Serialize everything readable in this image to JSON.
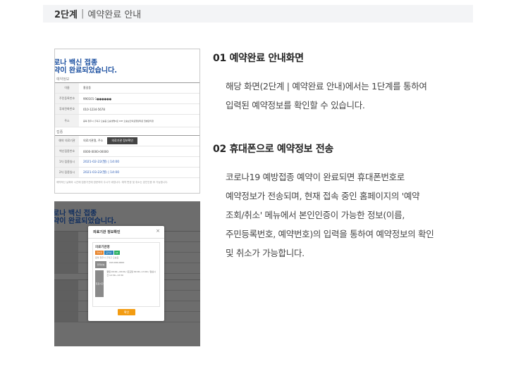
{
  "header": {
    "step": "2단계",
    "separator": "|",
    "title": "예약완료 안내"
  },
  "thumb1": {
    "line1": "로나 백신 접종",
    "line2": "약이 완료되었습니다.",
    "section1": "예약정보",
    "rows1": [
      {
        "key": "이름",
        "value": "홍길동"
      },
      {
        "key": "주민등록번호",
        "value": "990101-1●●●●●●"
      },
      {
        "key": "휴대전화번호",
        "value": "010-1234-5678"
      },
      {
        "key": "주소",
        "value": "충북 청주시 흥덕구 오송읍 오송생명2로 187 오송보건의료행정타운 질병관리청"
      }
    ],
    "section2": "접종",
    "rows2": [
      {
        "key": "예약 의료기관",
        "value": "의료기관명, 주소",
        "button": "의료기관 정보확인"
      },
      {
        "key": "백신접종번호",
        "value": "0000-0000-00000"
      },
      {
        "key": "1차 접종일시",
        "value": "2021-02-22(월) | 14:00"
      },
      {
        "key": "2차 접종일시",
        "value": "2021-03-22(월) | 14:00"
      }
    ],
    "footnote": "예약하신 날짜와 시간에 접종기관에 방문하여 주시기 바랍니다. 예약 변경 및 취소는 본인인증 후 가능합니다."
  },
  "thumb2": {
    "line1": "로나 백신 접종",
    "line2": "약이 완료되었습니다.",
    "modal": {
      "title": "의료기관 정보확인",
      "close": "×",
      "clinic_name": "의료기관명",
      "tags": [
        {
          "label": "화이자",
          "color": "#e67e22"
        },
        {
          "label": "모더나",
          "color": "#2980b9"
        },
        {
          "label": "AZ",
          "color": "#27ae60"
        }
      ],
      "address": "충북 청주시 흥덕구 오송읍",
      "rows": [
        {
          "key": "전화번호",
          "value": "043-000-0000"
        },
        {
          "key": "진료시간",
          "value": "평일 09:00~18:00 / 토요일 09:00~13:00 / 점심시간 12:30~13:30"
        }
      ],
      "confirm": "확인"
    }
  },
  "section1": {
    "heading": "01 예약완료 안내화면",
    "lines": [
      "해당 화면(2단계 | 예약완료 안내)에서는 1단계를 통하여",
      "입력된 예약정보를 확인할 수 있습니다."
    ]
  },
  "section2": {
    "heading": "02 휴대폰으로 예약정보 전송",
    "lines": [
      "코로나19 예방접종 예약이 완료되면 휴대폰번호로",
      "예약정보가 전송되며, 현재 접속 중인 홈페이지의 '예약",
      "조회/취소' 메뉴에서 본인인증이 가능한 정보(이름,",
      "주민등록번호, 예약번호)의 입력을 통하여 예약정보의 확인",
      "및 취소가 가능합니다."
    ]
  }
}
